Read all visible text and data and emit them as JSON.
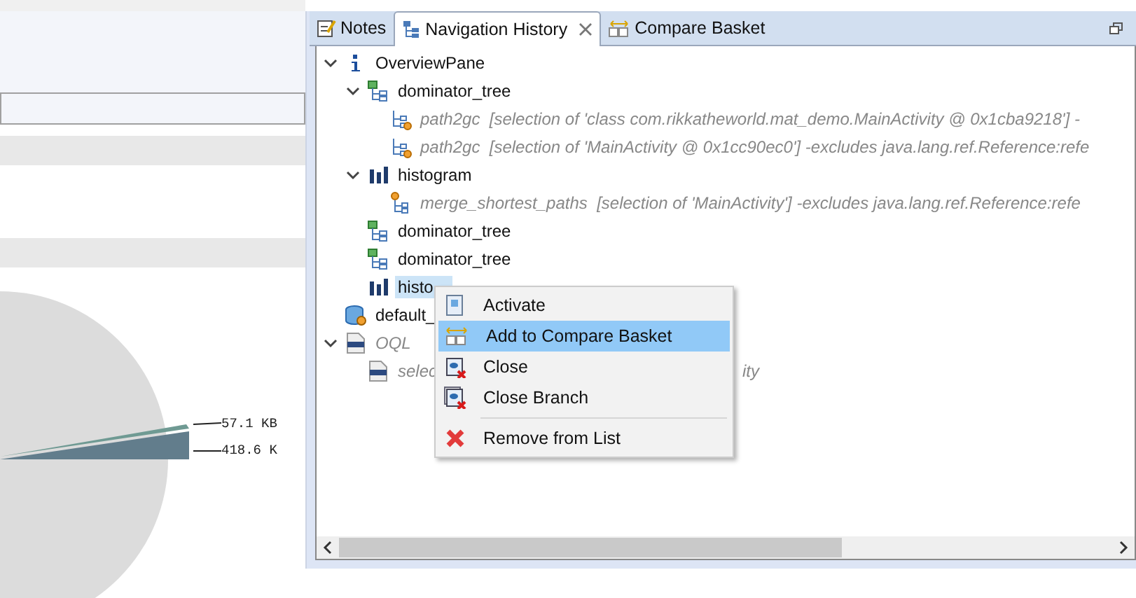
{
  "pie_labels": [
    "57.1 KB",
    "418.6 K"
  ],
  "tabs": [
    {
      "label": "Notes",
      "kind": "notes",
      "selected": false,
      "closable": false
    },
    {
      "label": "Navigation History",
      "kind": "history",
      "selected": true,
      "closable": true
    },
    {
      "label": "Compare Basket",
      "kind": "basket",
      "selected": false,
      "closable": false
    }
  ],
  "tree": [
    {
      "kind": "info",
      "label": "OverviewPane",
      "greyed": false,
      "selected": false,
      "expanded": true,
      "children": [
        {
          "kind": "dominator",
          "label": "dominator_tree",
          "greyed": false,
          "selected": false,
          "expanded": true,
          "children": [
            {
              "kind": "path",
              "label": "path2gc  [selection of 'class com.rikkatheworld.mat_demo.MainActivity @ 0x1cba9218'] -",
              "greyed": true,
              "selected": false
            },
            {
              "kind": "path",
              "label": "path2gc  [selection of 'MainActivity @ 0x1cc90ec0'] -excludes java.lang.ref.Reference:refe",
              "greyed": true,
              "selected": false
            }
          ]
        },
        {
          "kind": "histogram",
          "label": "histogram",
          "greyed": false,
          "selected": false,
          "expanded": true,
          "children": [
            {
              "kind": "merge",
              "label": "merge_shortest_paths  [selection of 'MainActivity'] -excludes java.lang.ref.Reference:refe",
              "greyed": true,
              "selected": false
            }
          ]
        },
        {
          "kind": "dominator",
          "label": "dominator_tree",
          "greyed": false,
          "selected": false
        },
        {
          "kind": "dominator",
          "label": "dominator_tree",
          "greyed": false,
          "selected": false
        },
        {
          "kind": "histogram",
          "label": "histo",
          "greyed": false,
          "selected": true
        }
      ]
    },
    {
      "kind": "heap",
      "label": "default_",
      "greyed": false,
      "selected": false
    },
    {
      "kind": "oql",
      "label": "OQL",
      "greyed": true,
      "selected": false,
      "expanded": true,
      "children": [
        {
          "kind": "query",
          "label": "selec",
          "tail": "ity",
          "greyed": true,
          "selected": false
        }
      ]
    }
  ],
  "context_menu": [
    {
      "kind": "activate",
      "label": "Activate",
      "selected": false,
      "separator_before": false
    },
    {
      "kind": "basket",
      "label": "Add to Compare Basket",
      "selected": true,
      "separator_before": false
    },
    {
      "kind": "close",
      "label": "Close",
      "selected": false,
      "separator_before": false
    },
    {
      "kind": "close_branch",
      "label": "Close Branch",
      "selected": false,
      "separator_before": false
    },
    {
      "kind": "remove",
      "label": "Remove from List",
      "selected": false,
      "separator_before": true
    }
  ]
}
